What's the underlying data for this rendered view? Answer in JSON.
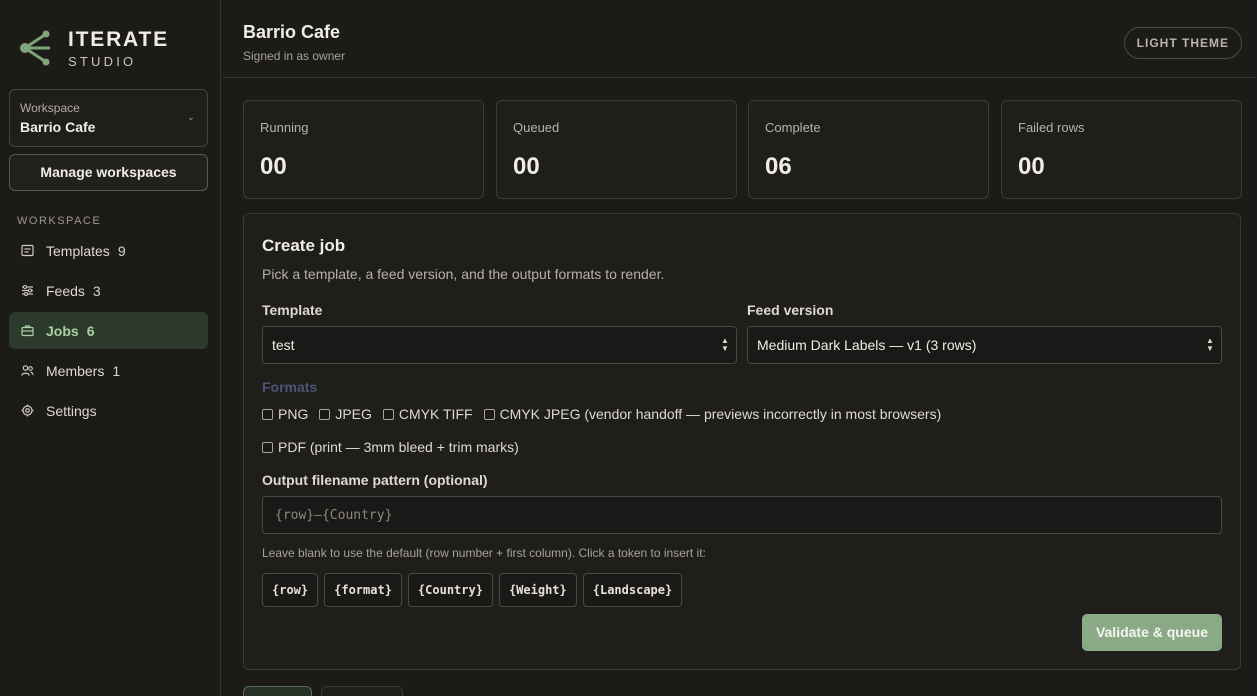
{
  "brand": {
    "name": "ITERATE",
    "sub": "STUDIO"
  },
  "workspace": {
    "label": "Workspace",
    "value": "Barrio Cafe"
  },
  "sidebar": {
    "manage_label": "Manage workspaces",
    "heading": "WORKSPACE",
    "items": [
      {
        "label": "Templates",
        "count": "9",
        "icon": "template-icon"
      },
      {
        "label": "Feeds",
        "count": "3",
        "icon": "sliders-icon"
      },
      {
        "label": "Jobs",
        "count": "6",
        "icon": "briefcase-icon",
        "active": true
      },
      {
        "label": "Members",
        "count": "1",
        "icon": "users-icon"
      },
      {
        "label": "Settings",
        "count": "",
        "icon": "gear-icon"
      }
    ]
  },
  "header": {
    "title": "Barrio Cafe",
    "subtitle": "Signed in as owner",
    "theme_label": "LIGHT THEME"
  },
  "stats": [
    {
      "label": "Running",
      "value": "00"
    },
    {
      "label": "Queued",
      "value": "00"
    },
    {
      "label": "Complete",
      "value": "06"
    },
    {
      "label": "Failed rows",
      "value": "00"
    }
  ],
  "create_job": {
    "title": "Create job",
    "description": "Pick a template, a feed version, and the output formats to render.",
    "template_label": "Template",
    "template_value": "test",
    "feed_label": "Feed version",
    "feed_value": "Medium Dark Labels — v1 (3 rows)",
    "formats_label": "Formats",
    "formats": [
      "PNG",
      "JPEG",
      "CMYK TIFF",
      "CMYK JPEG (vendor handoff — previews incorrectly in most browsers)",
      "PDF (print — 3mm bleed + trim marks)"
    ],
    "pattern_label": "Output filename pattern (optional)",
    "pattern_placeholder": "{row}—{Country}",
    "hint": "Leave blank to use the default (row number + first column). Click a token to insert it:",
    "tokens": [
      "{row}",
      "{format}",
      "{Country}",
      "{Weight}",
      "{Landscape}"
    ],
    "submit_label": "Validate & queue"
  },
  "colors": {
    "accent": "#8aaa85",
    "background": "#1c1b18",
    "active_nav": "#2c3a2c"
  }
}
